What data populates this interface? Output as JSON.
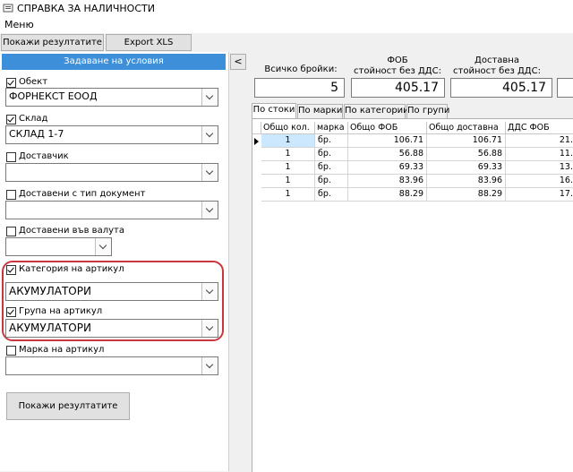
{
  "window": {
    "title": "СПРАВКА ЗА НАЛИЧНОСТИ"
  },
  "menu": {
    "label": "Меню"
  },
  "toolbar": {
    "show_results": "Покажи резултатите",
    "export": "Export XLS"
  },
  "panel": {
    "header": "Задаване на условия",
    "collapse": "<",
    "filters": [
      {
        "label": "Обект",
        "checked": true,
        "value": "ФОРНЕКСТ ЕООД"
      },
      {
        "label": "Склад",
        "checked": true,
        "value": "СКЛАД 1-7"
      },
      {
        "label": "Доставчик",
        "checked": false,
        "value": ""
      },
      {
        "label": "Доставени с тип документ",
        "checked": false,
        "value": ""
      },
      {
        "label": "Доставени във валута",
        "checked": false,
        "value": ""
      },
      {
        "label": "Категория на артикул",
        "checked": true,
        "value": "АКУМУЛАТОРИ"
      },
      {
        "label": "Група на артикул",
        "checked": true,
        "value": "АКУМУЛАТОРИ"
      },
      {
        "label": "Марка на артикул",
        "checked": false,
        "value": ""
      }
    ],
    "show_button": "Покажи резултатите"
  },
  "stats": [
    {
      "label1": "",
      "label2": "Всичко бройки:",
      "value": "5"
    },
    {
      "label1": "ФОБ",
      "label2": "стойност без ДДС:",
      "value": "405.17"
    },
    {
      "label1": "Доставна",
      "label2": "стойност без ДДС:",
      "value": "405.17"
    }
  ],
  "tabs": [
    "По стоки",
    "По марки",
    "По категории",
    "По групи"
  ],
  "grid": {
    "columns": [
      "Общо кол.",
      "марка",
      "Общо ФОБ",
      "Общо доставна",
      "ДДС ФОБ"
    ],
    "rows": [
      [
        "1",
        "бр.",
        "106.71",
        "106.71",
        "21."
      ],
      [
        "1",
        "бр.",
        "56.88",
        "56.88",
        "11."
      ],
      [
        "1",
        "бр.",
        "69.33",
        "69.33",
        "13."
      ],
      [
        "1",
        "бр.",
        "83.96",
        "83.96",
        "16."
      ],
      [
        "1",
        "бр.",
        "88.29",
        "88.29",
        "17."
      ]
    ]
  }
}
